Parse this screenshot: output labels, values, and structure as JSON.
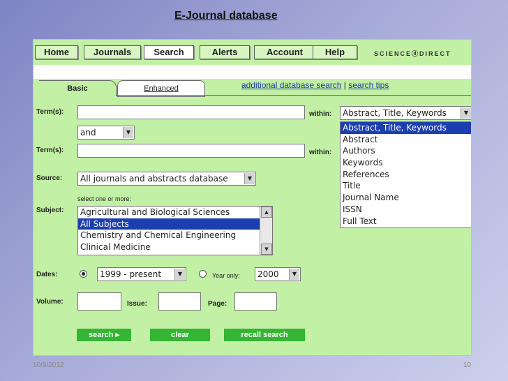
{
  "slide": {
    "title": "E-Journal database",
    "date": "10/9/2012",
    "page": "10"
  },
  "nav": {
    "items": [
      "Home",
      "Journals",
      "Search",
      "Alerts",
      "Account",
      "Help"
    ],
    "brand": "SCIENCEⓓDIRECT"
  },
  "tabs": {
    "basic": "Basic",
    "enhanced": "Enhanced"
  },
  "links": {
    "additional": "additional database search",
    "sep": "|",
    "tips": "search tips"
  },
  "form": {
    "terms_label": "Term(s):",
    "term1": "",
    "term2": "",
    "operator": "and",
    "within_label": "within:",
    "within_selected": "Abstract, Title, Keywords",
    "within_options": [
      "Abstract, Title, Keywords",
      "Abstract",
      "Authors",
      "Keywords",
      "References",
      "Title",
      "Journal Name",
      "ISSN",
      "Full Text"
    ],
    "source_label": "Source:",
    "source_value": "All journals and abstracts database",
    "subject_hint": "select one or more:",
    "subject_label": "Subject:",
    "subjects": [
      "Agricultural and Biological Sciences",
      "All Subjects",
      "Chemistry and Chemical Engineering",
      "Clinical Medicine"
    ],
    "subject_selected_index": 1,
    "dates_label": "Dates:",
    "date_range": "1999 - present",
    "year_only_label": "Year only:",
    "year_value": "2000",
    "volume_label": "Volume:",
    "issue_label": "Issue:",
    "page_label": "Page:",
    "buttons": {
      "search": "search ▸",
      "clear": "clear",
      "recall": "recall search"
    }
  }
}
